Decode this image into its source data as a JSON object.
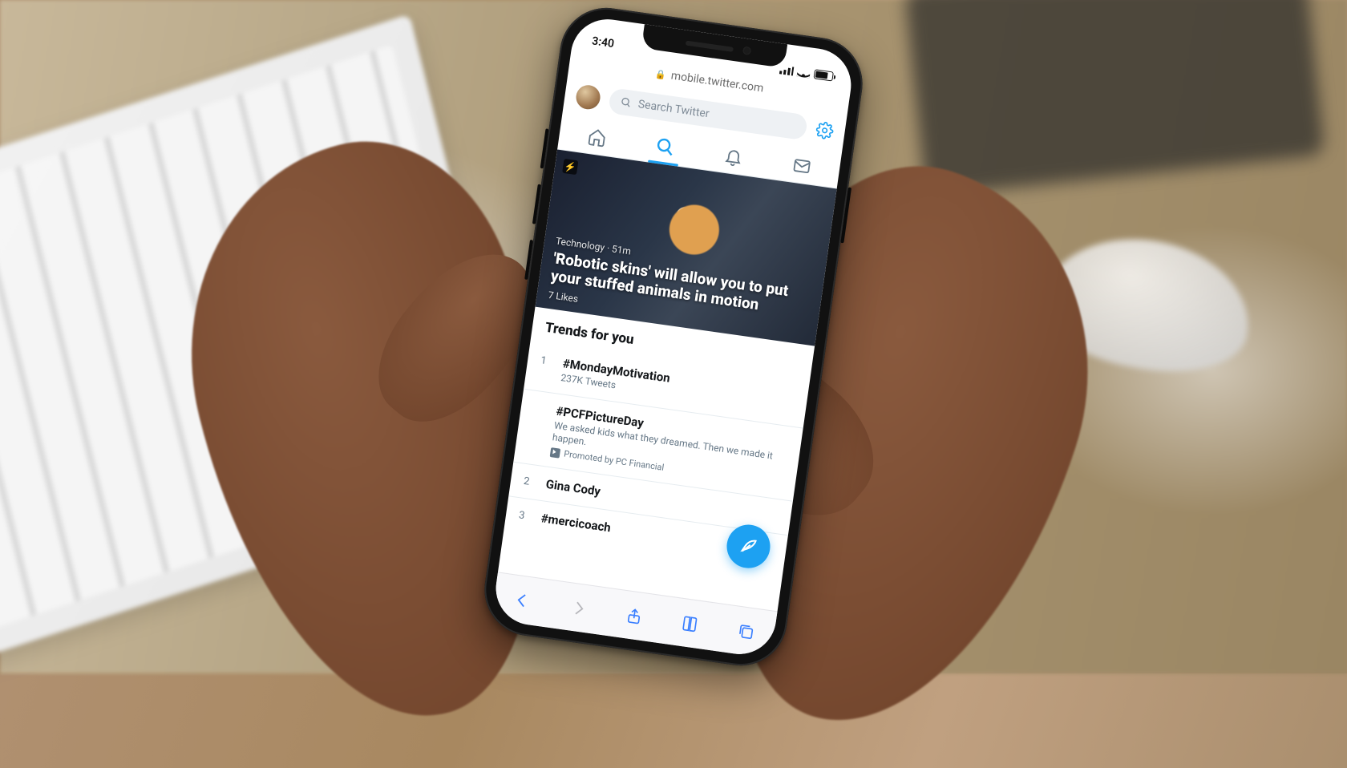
{
  "status": {
    "time": "3:40"
  },
  "browser": {
    "url": "mobile.twitter.com"
  },
  "header": {
    "search_placeholder": "Search Twitter"
  },
  "hero": {
    "category": "Technology",
    "age": "51m",
    "meta": "Technology · 51m",
    "title": "'Robotic skins' will allow you to put your stuffed animals in motion",
    "likes": "7 Likes"
  },
  "trends": {
    "section_title": "Trends for you",
    "items": [
      {
        "rank": "1",
        "name": "#MondayMotivation",
        "sub": "237K Tweets"
      },
      {
        "rank": "",
        "name": "#PCFPictureDay",
        "sub": "We asked kids what they dreamed. Then we made it happen.",
        "promoted_by": "Promoted by PC Financial"
      },
      {
        "rank": "2",
        "name": "Gina Cody",
        "sub": ""
      },
      {
        "rank": "3",
        "name": "#mercicoach",
        "sub": ""
      }
    ]
  },
  "colors": {
    "twitter_blue": "#1da1f2",
    "text_gray": "#657786"
  }
}
